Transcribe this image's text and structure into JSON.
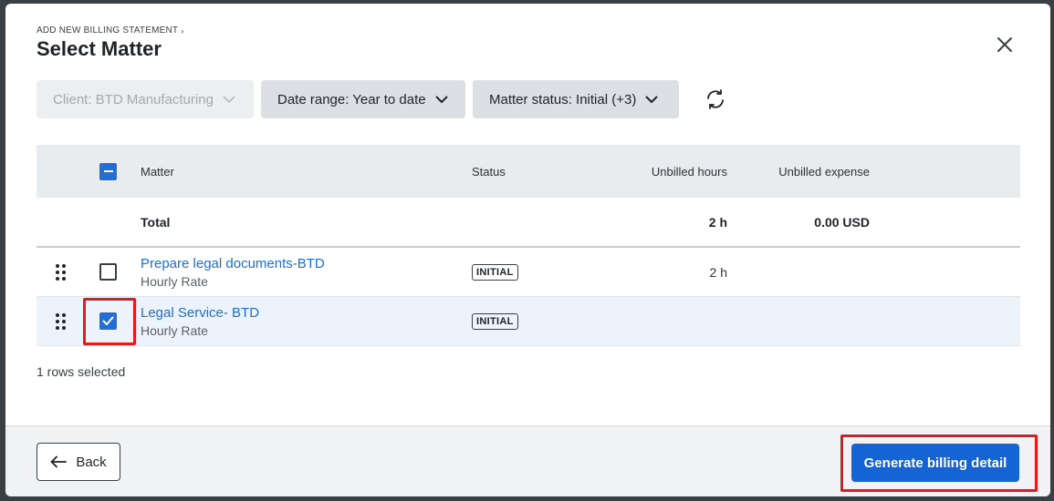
{
  "header": {
    "breadcrumb": "ADD NEW BILLING STATEMENT",
    "title": "Select Matter"
  },
  "filters": [
    {
      "label": "Client: BTD Manufacturing",
      "disabled": true
    },
    {
      "label": "Date range: Year to date",
      "disabled": false
    },
    {
      "label": "Matter status: Initial (+3)",
      "disabled": false
    }
  ],
  "table": {
    "columns": {
      "matter": "Matter",
      "status": "Status",
      "hours": "Unbilled hours",
      "expense": "Unbilled expense"
    },
    "total": {
      "label": "Total",
      "hours": "2 h",
      "expense": "0.00 USD"
    },
    "rows": [
      {
        "name": "Prepare legal documents-BTD",
        "rate": "Hourly Rate",
        "status": "INITIAL",
        "hours": "2 h",
        "expense": "",
        "checked": false
      },
      {
        "name": "Legal Service- BTD",
        "rate": "Hourly Rate",
        "status": "INITIAL",
        "hours": "",
        "expense": "",
        "checked": true
      }
    ]
  },
  "selection_text": "1 rows selected",
  "footer": {
    "back_label": "Back",
    "generate_label": "Generate billing detail"
  },
  "colors": {
    "primary": "#1464d6",
    "link": "#1d6ed8",
    "highlight": "#e3191c"
  }
}
